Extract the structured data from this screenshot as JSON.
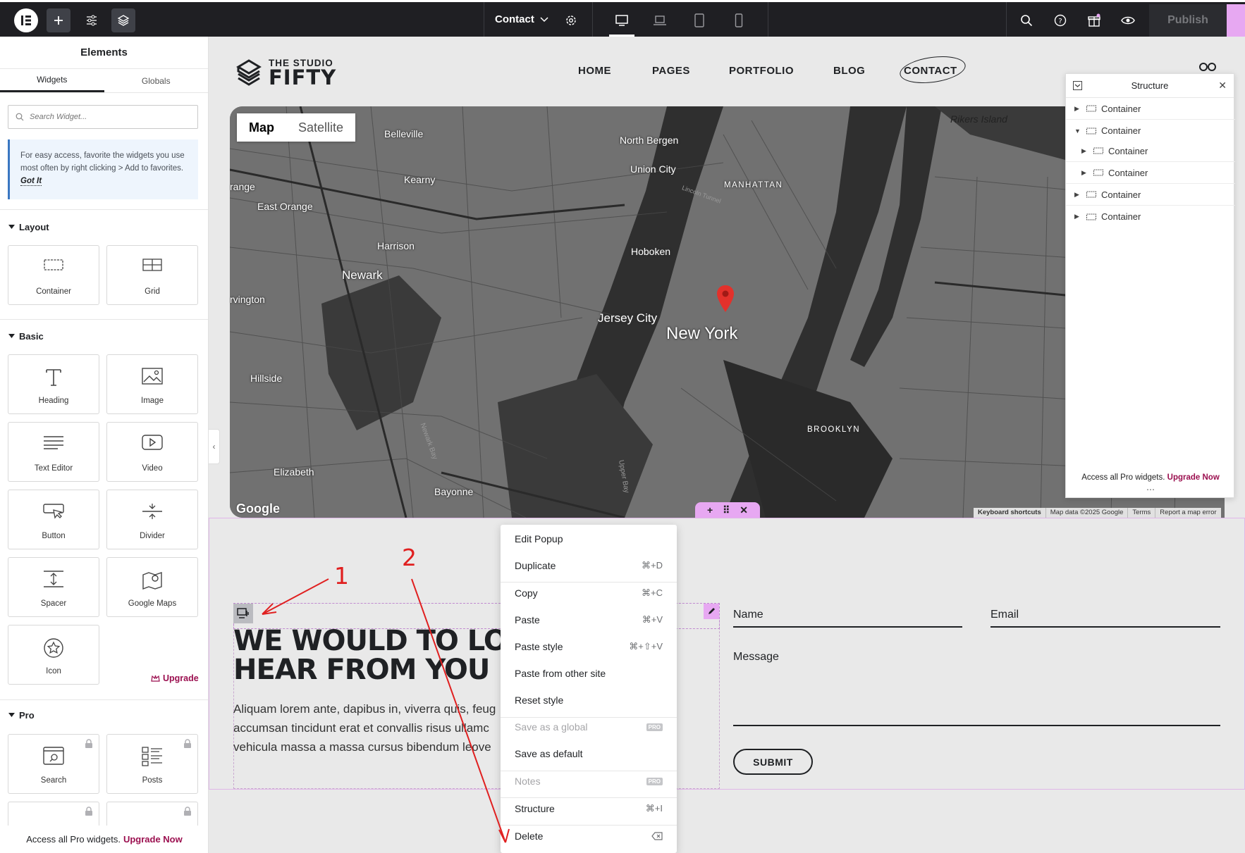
{
  "topbar": {
    "page_name": "Contact",
    "publish_label": "Publish",
    "active_device": "desktop"
  },
  "panel": {
    "title": "Elements",
    "tabs": [
      {
        "label": "Widgets",
        "active": true
      },
      {
        "label": "Globals",
        "active": false
      }
    ],
    "search_placeholder": "Search Widget...",
    "tip_text": "For easy access, favorite the widgets you use most often by right clicking > Add to favorites.",
    "tip_link": "Got It",
    "categories": [
      {
        "title": "Layout",
        "widgets": [
          {
            "label": "Container",
            "icon": "container-icon"
          },
          {
            "label": "Grid",
            "icon": "grid-icon"
          }
        ]
      },
      {
        "title": "Basic",
        "widgets": [
          {
            "label": "Heading",
            "icon": "heading-icon"
          },
          {
            "label": "Image",
            "icon": "image-icon"
          },
          {
            "label": "Text Editor",
            "icon": "text-editor-icon"
          },
          {
            "label": "Video",
            "icon": "video-icon"
          },
          {
            "label": "Button",
            "icon": "button-icon"
          },
          {
            "label": "Divider",
            "icon": "divider-icon"
          },
          {
            "label": "Spacer",
            "icon": "spacer-icon"
          },
          {
            "label": "Google Maps",
            "icon": "map-icon"
          },
          {
            "label": "Icon",
            "icon": "star-icon"
          }
        ]
      },
      {
        "title": "Pro",
        "upgrade_label": "Upgrade",
        "widgets": [
          {
            "label": "Search",
            "icon": "search-widget-icon"
          },
          {
            "label": "Posts",
            "icon": "posts-icon"
          }
        ]
      }
    ],
    "footer_text": "Access all Pro widgets.",
    "footer_link": "Upgrade Now"
  },
  "site": {
    "brand_line1": "THE STUDIO",
    "brand_line2": "FIFTY",
    "nav": [
      "HOME",
      "PAGES",
      "PORTFOLIO",
      "BLOG",
      "CONTACT"
    ]
  },
  "map": {
    "toggle": [
      "Map",
      "Satellite"
    ],
    "labels": [
      "Belleville",
      "North Bergen",
      "Rikers Island",
      "Kearny",
      "Union City",
      "MANHATTAN",
      "range",
      "East Orange",
      "Harrison",
      "Hoboken",
      "Newark",
      "rvington",
      "Jersey City",
      "New York",
      "Hillside",
      "BROOKLYN",
      "Elizabeth",
      "Bayonne",
      "Newark Bay",
      "Upper Bay",
      "Lincoln Tunnel"
    ],
    "attribution": [
      "Keyboard shortcuts",
      "Map data ©2025 Google",
      "Terms",
      "Report a map error"
    ],
    "logo": "Google"
  },
  "form_section": {
    "heading_line1": "WE WOULD TO LO",
    "heading_line2": "HEAR FROM YOU",
    "paragraph": [
      "Aliquam lorem ante, dapibus in, viverra quis, feug",
      "accumsan tincidunt erat et convallis risus ullamc",
      "vehicula massa a massa cursus bibendum leove"
    ],
    "fields": {
      "name": "Name",
      "email": "Email",
      "message": "Message"
    },
    "submit_label": "SUBMIT"
  },
  "context_menu": {
    "items": [
      {
        "label": "Edit Popup",
        "shortcut": ""
      },
      {
        "label": "Duplicate",
        "shortcut": "⌘+D"
      },
      {
        "label": "Copy",
        "shortcut": "⌘+C"
      },
      {
        "label": "Paste",
        "shortcut": "⌘+V"
      },
      {
        "label": "Paste style",
        "shortcut": "⌘+⇧+V"
      },
      {
        "label": "Paste from other site",
        "shortcut": ""
      },
      {
        "label": "Reset style",
        "shortcut": ""
      },
      {
        "label": "Save as a global",
        "shortcut": "PRO"
      },
      {
        "label": "Save as default",
        "shortcut": ""
      },
      {
        "label": "Notes",
        "shortcut": "PRO"
      },
      {
        "label": "Structure",
        "shortcut": "⌘+I"
      },
      {
        "label": "Delete",
        "shortcut": ""
      }
    ]
  },
  "structure": {
    "title": "Structure",
    "rows": [
      {
        "label": "Container",
        "expanded": false
      },
      {
        "label": "Container",
        "expanded": true
      },
      {
        "label": "Container",
        "expanded": false
      },
      {
        "label": "Container",
        "expanded": false
      },
      {
        "label": "Container",
        "expanded": false
      },
      {
        "label": "Container",
        "expanded": false
      }
    ],
    "footer_text": "Access all Pro widgets.",
    "footer_link": "Upgrade Now"
  },
  "annotations": {
    "labels": [
      "1",
      "2"
    ],
    "color": "#e02020"
  },
  "colors": {
    "accent_pink": "#e7a8f2",
    "upgrade": "#9b0f4f",
    "topbar": "#1f1f23"
  }
}
